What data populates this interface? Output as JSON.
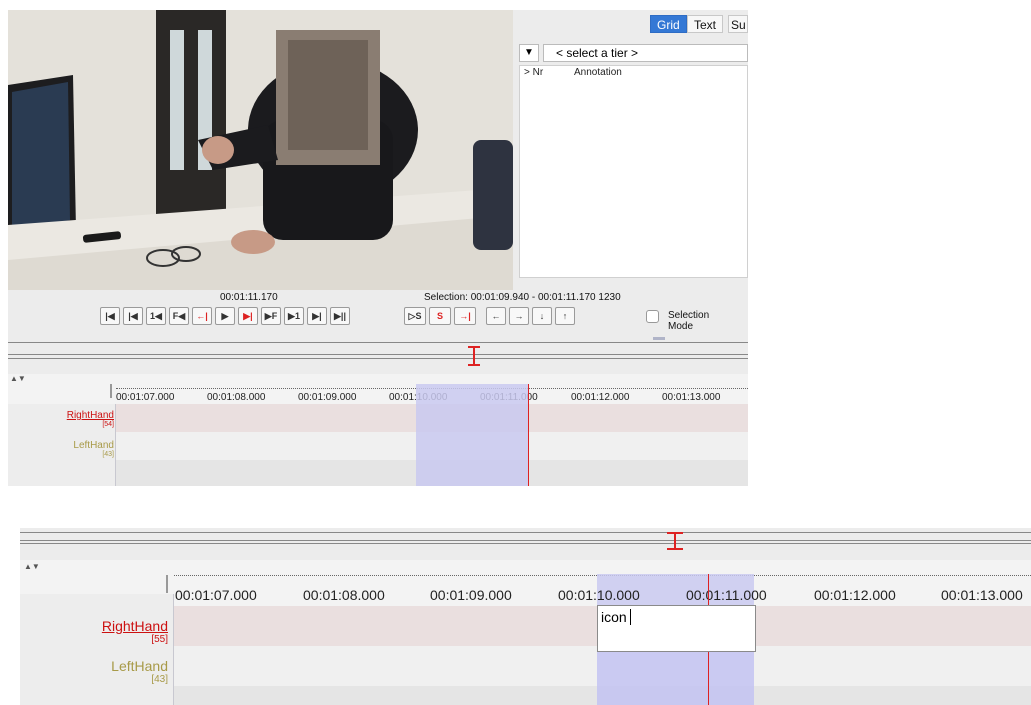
{
  "top": {
    "tabs": [
      "Grid",
      "Text",
      "Su"
    ],
    "tier_select": "< select a tier >",
    "grid_columns": [
      "> Nr",
      "Annotation"
    ],
    "current_time": "00:01:11.170",
    "selection_label": "Selection: 00:01:09.940 - 00:01:11.170  1230",
    "selection_mode": "Selection Mode",
    "media_buttons": [
      "|◀",
      "|◀",
      "1◀",
      "F◀",
      "←|",
      "▶",
      "▶|",
      "▶F",
      "▶1",
      "▶|",
      "▶||"
    ],
    "selection_buttons": [
      "▷S",
      "S",
      "→|"
    ],
    "nav_buttons": [
      "←",
      "→",
      "↓",
      "↑"
    ],
    "ticks": [
      "00:01:07.000",
      "00:01:08.000",
      "00:01:09.000",
      "00:01:10.000",
      "00:01:11.000",
      "00:01:12.000",
      "00:01:13.000"
    ],
    "tiers": [
      {
        "name": "RightHand",
        "count": "[54]",
        "color": "#cc1111"
      },
      {
        "name": "LeftHand",
        "count": "[43]",
        "color": "#a89a48"
      }
    ]
  },
  "bottom": {
    "ticks": [
      "00:01:07.000",
      "00:01:08.000",
      "00:01:09.000",
      "00:01:10.000",
      "00:01:11.000",
      "00:01:12.000",
      "00:01:13.000"
    ],
    "tiers": [
      {
        "name": "RightHand",
        "count": "[55]",
        "color": "#cc1111"
      },
      {
        "name": "LeftHand",
        "count": "[43]",
        "color": "#a89a48"
      }
    ],
    "edit_value": "icon"
  }
}
